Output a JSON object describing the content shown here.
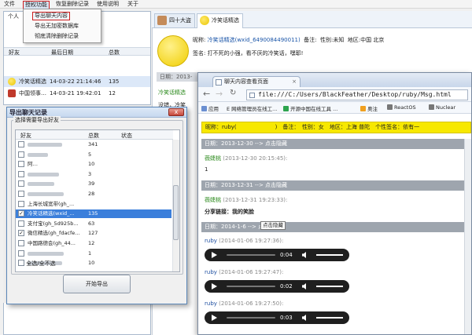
{
  "menubar": [
    "文件",
    "授权功能",
    "恢复删除记录",
    "使用说明",
    "关于"
  ],
  "dropdown": [
    "导出聊天内容",
    "导出无加密数据库",
    "彻底清除删除记录"
  ],
  "left_panel": {
    "label": "个人",
    "columns": [
      "好友",
      "最后日期",
      "总数"
    ],
    "rows": [
      {
        "name": "冷笑话精选",
        "date": "14-03-22 21:14:46",
        "count": "135"
      },
      {
        "name": "中国领事…",
        "date": "14-03-21 19:42:01",
        "count": "12"
      }
    ]
  },
  "chat": {
    "tabs": [
      "四十大盗",
      "冷笑话精选"
    ],
    "nickname_label": "昵称:",
    "nickname": "冷笑话精选(wxid_6490084490011)",
    "remark_label": "备注:",
    "gender_label": "性别:",
    "gender": "未知",
    "region_label": "地区:",
    "region": "中国 北京",
    "sign_label": "签名:",
    "sign": "打不死的小强，看不厌的冷笑话，嘿耶!",
    "date_row": "日期：2013-",
    "extra": [
      "冷笑话精选",
      "没错，冷笑"
    ]
  },
  "dialog": {
    "title": "导出聊天记录",
    "close": "x",
    "group_label": "选择需要导出好友",
    "columns": [
      "好友",
      "总数",
      "状态"
    ],
    "rows": [
      {
        "name": "",
        "count": "341",
        "checked": false
      },
      {
        "name": "",
        "count": "5",
        "checked": false
      },
      {
        "name": "阿…",
        "count": "10",
        "checked": false
      },
      {
        "name": "",
        "count": "3",
        "checked": false
      },
      {
        "name": "",
        "count": "39",
        "checked": false
      },
      {
        "name": "",
        "count": "28",
        "checked": false
      },
      {
        "name": "上海长城宽带(gh_...",
        "count": "",
        "checked": false
      },
      {
        "name": "冷笑话精选(wxid_...",
        "count": "135",
        "checked": true,
        "highlight": true
      },
      {
        "name": "支付宝(gh_5d925b...",
        "count": "63",
        "checked": false
      },
      {
        "name": "微信精选(gh_fdacfe...",
        "count": "127",
        "checked": true
      },
      {
        "name": "中国路德会(gh_44...",
        "count": "12",
        "checked": false
      },
      {
        "name": "",
        "count": "1",
        "checked": false
      },
      {
        "name": "",
        "count": "10",
        "checked": false
      }
    ],
    "select_all": "全选/全不选",
    "export_button": "开始导出"
  },
  "browser": {
    "tab_title": "聊天内容查看页面",
    "url": "file:///C:/Users/BlackFeather/Desktop/ruby/Msg.html",
    "bookmarks": [
      "应用",
      "E 网络管理员在线工...",
      "开源中国在线工具 ...",
      "奥注",
      "ReactOS",
      "Nuclear"
    ],
    "header": "昵称：ruby(　　　　　　　)　备注：　性别：女　地区：上海 普陀　个性签名：依有一",
    "blocks": [
      {
        "type": "date",
        "text": "日期：2013-12-30 --> 点击隐藏"
      },
      {
        "type": "msg",
        "name": "薇婕桃",
        "time": "(2013-12-30 20:15:45):",
        "text": "1",
        "color": "green"
      },
      {
        "type": "date",
        "text": "日期：2013-12-31 --> 点击隐藏"
      },
      {
        "type": "msg",
        "name": "薇婕桃",
        "time": "(2013-12-31 19:23:33):",
        "text": "分享链接：我的笑脸",
        "color": "green"
      },
      {
        "type": "date",
        "text": "日期：2014-1-6 --> 点击隐藏"
      },
      {
        "type": "audio",
        "name": "ruby",
        "time": "(2014-01-06 19:27:36):",
        "duration": "0:04"
      },
      {
        "type": "audio",
        "name": "ruby",
        "time": "(2014-01-06 19:27:47):",
        "duration": "0:02"
      },
      {
        "type": "audio",
        "name": "ruby",
        "time": "(2014-01-06 19:27:50):",
        "duration": "0:03"
      }
    ],
    "tooltip": "点击隐藏"
  }
}
